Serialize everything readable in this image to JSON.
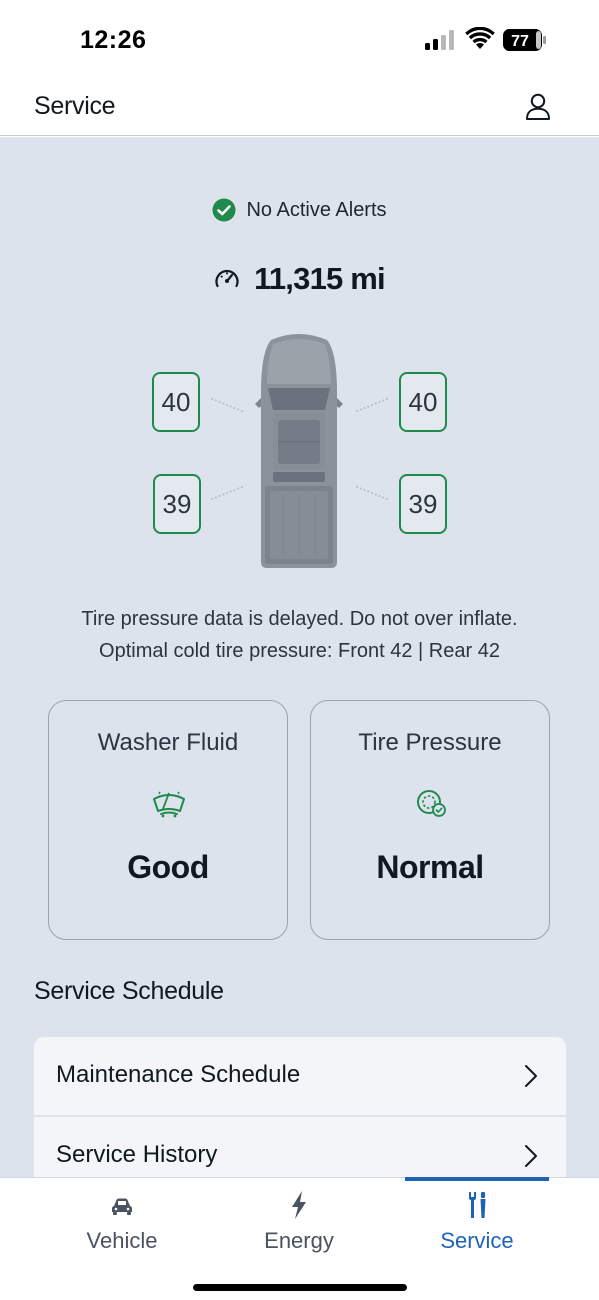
{
  "status_bar": {
    "time": "12:26",
    "battery_level": "77",
    "icons": [
      "cellular-signal-icon",
      "wifi-icon",
      "battery-icon"
    ]
  },
  "header": {
    "title": "Service",
    "profile_icon": "person-icon"
  },
  "alerts": {
    "text": "No Active Alerts",
    "icon": "check-circle-icon",
    "color": "#1f8a4c"
  },
  "odometer": {
    "value": "11,315 mi",
    "icon": "speedometer-icon"
  },
  "tires": {
    "front_left": "40",
    "front_right": "40",
    "rear_left": "39",
    "rear_right": "39",
    "border_color": "#1f8a4c"
  },
  "pressure_note": {
    "line1": "Tire pressure data is delayed. Do not over inflate.",
    "line2": "Optimal cold tire pressure: Front 42 | Rear 42"
  },
  "cards": [
    {
      "title": "Washer Fluid",
      "icon": "windshield-washer-icon",
      "value": "Good"
    },
    {
      "title": "Tire Pressure",
      "icon": "tire-pressure-icon",
      "value": "Normal"
    }
  ],
  "service_schedule": {
    "title": "Service Schedule",
    "items": [
      {
        "label": "Maintenance Schedule"
      },
      {
        "label": "Service History"
      }
    ]
  },
  "bottom_nav": {
    "tabs": [
      {
        "label": "Vehicle",
        "icon": "car-icon",
        "active": false
      },
      {
        "label": "Energy",
        "icon": "lightning-bolt-icon",
        "active": false
      },
      {
        "label": "Service",
        "icon": "tools-icon",
        "active": true
      }
    ],
    "accent": "#1d64b5"
  }
}
